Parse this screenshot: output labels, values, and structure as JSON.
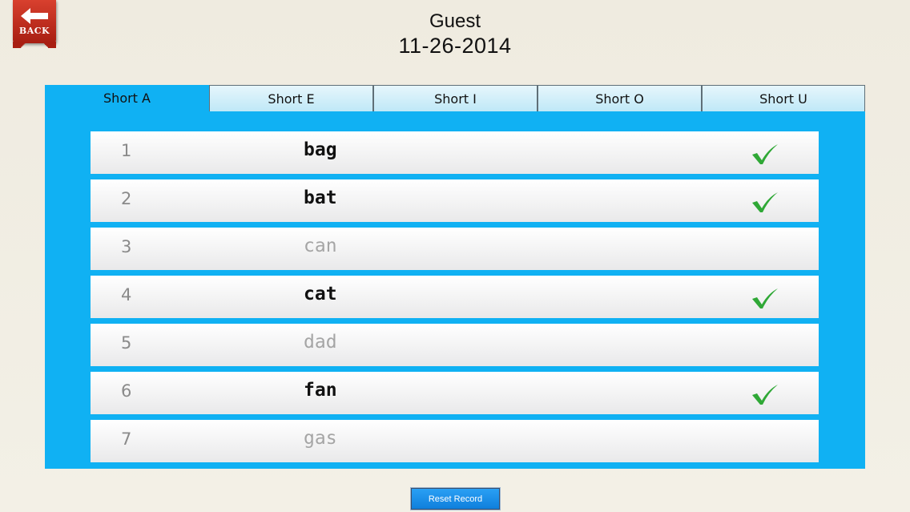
{
  "nav": {
    "back_label": "BACK"
  },
  "header": {
    "user": "Guest",
    "date": "11-26-2014"
  },
  "tabs": [
    {
      "label": "Short A",
      "active": true
    },
    {
      "label": "Short E",
      "active": false
    },
    {
      "label": "Short I",
      "active": false
    },
    {
      "label": "Short O",
      "active": false
    },
    {
      "label": "Short U",
      "active": false
    }
  ],
  "words": [
    {
      "num": "1",
      "word": "bag",
      "completed": true
    },
    {
      "num": "2",
      "word": "bat",
      "completed": true
    },
    {
      "num": "3",
      "word": "can",
      "completed": false
    },
    {
      "num": "4",
      "word": "cat",
      "completed": true
    },
    {
      "num": "5",
      "word": "dad",
      "completed": false
    },
    {
      "num": "6",
      "word": "fan",
      "completed": true
    },
    {
      "num": "7",
      "word": "gas",
      "completed": false
    }
  ],
  "footer": {
    "reset_label": "Reset Record"
  },
  "colors": {
    "panel": "#10b1f3",
    "check": "#2fa836",
    "back": "#c0291b"
  }
}
